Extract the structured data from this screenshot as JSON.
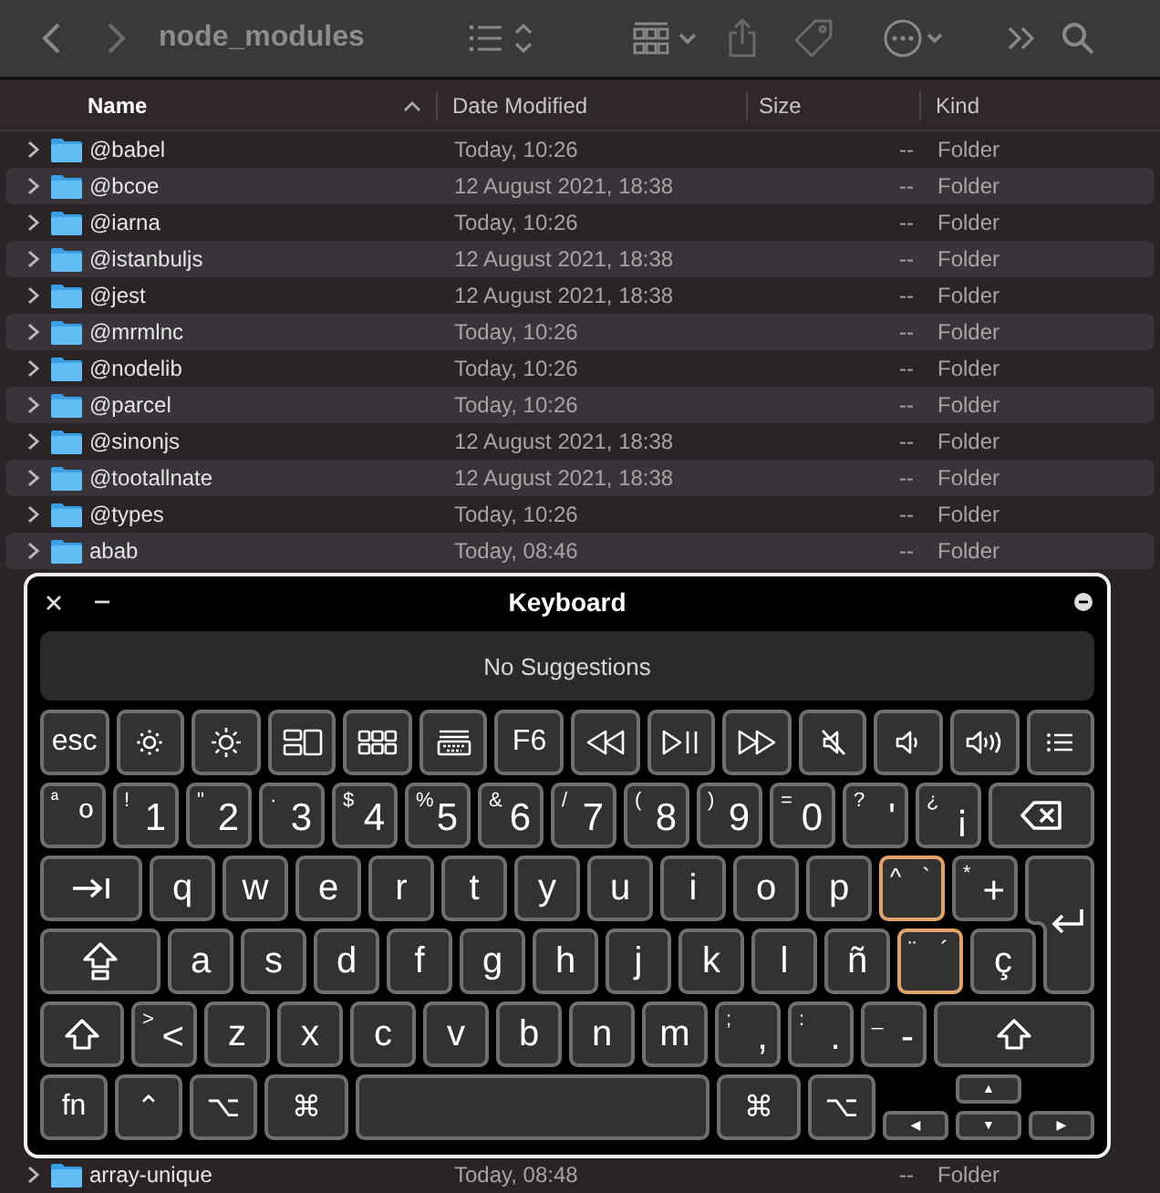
{
  "toolbar": {
    "title": "node_modules"
  },
  "columns": [
    {
      "label": "Name",
      "sorted": true
    },
    {
      "label": "Date Modified",
      "sorted": false
    },
    {
      "label": "Size",
      "sorted": false
    },
    {
      "label": "Kind",
      "sorted": false
    }
  ],
  "rows": [
    {
      "name": "@babel",
      "date": "Today, 10:26",
      "size": "--",
      "kind_text": "Folder",
      "expanded": false
    },
    {
      "name": "@bcoe",
      "date": "12 August 2021, 18:38",
      "size": "--",
      "kind_text": "Folder",
      "expanded": false
    },
    {
      "name": "@iarna",
      "date": "Today, 10:26",
      "size": "--",
      "kind_text": "Folder",
      "expanded": false
    },
    {
      "name": "@istanbuljs",
      "date": "12 August 2021, 18:38",
      "size": "--",
      "kind_text": "Folder",
      "expanded": false
    },
    {
      "name": "@jest",
      "date": "12 August 2021, 18:38",
      "size": "--",
      "kind_text": "Folder",
      "expanded": false
    },
    {
      "name": "@mrmlnc",
      "date": "Today, 10:26",
      "size": "--",
      "kind_text": "Folder",
      "expanded": false
    },
    {
      "name": "@nodelib",
      "date": "Today, 10:26",
      "size": "--",
      "kind_text": "Folder",
      "expanded": false
    },
    {
      "name": "@parcel",
      "date": "Today, 10:26",
      "size": "--",
      "kind_text": "Folder",
      "expanded": false
    },
    {
      "name": "@sinonjs",
      "date": "12 August 2021, 18:38",
      "size": "--",
      "kind_text": "Folder",
      "expanded": false
    },
    {
      "name": "@tootallnate",
      "date": "12 August 2021, 18:38",
      "size": "--",
      "kind_text": "Folder",
      "expanded": false
    },
    {
      "name": "@types",
      "date": "Today, 10:26",
      "size": "--",
      "kind_text": "Folder",
      "expanded": false
    },
    {
      "name": "abab",
      "date": "Today, 08:46",
      "size": "--",
      "kind_text": "Folder",
      "expanded": false
    }
  ],
  "bottom_rows": [
    {
      "name": "array-unique",
      "date": "Today, 08:48",
      "size": "--",
      "kind_text": "Folder",
      "expanded": false
    }
  ],
  "keyboard": {
    "title": "Keyboard",
    "suggestions": "No Suggestions",
    "rows": [
      [
        {
          "kind": "label",
          "label": "esc",
          "highlighted": false
        },
        {
          "kind": "icon",
          "highlighted": false
        },
        {
          "kind": "icon",
          "highlighted": false
        },
        {
          "kind": "icon",
          "highlighted": false
        },
        {
          "kind": "icon",
          "highlighted": false
        },
        {
          "kind": "icon",
          "highlighted": false
        },
        {
          "kind": "label",
          "label": "F6",
          "highlighted": false
        },
        {
          "kind": "icon",
          "highlighted": false
        },
        {
          "kind": "icon",
          "highlighted": false
        },
        {
          "kind": "icon",
          "highlighted": false
        },
        {
          "kind": "icon",
          "highlighted": false
        },
        {
          "kind": "icon",
          "highlighted": false
        },
        {
          "kind": "icon",
          "highlighted": false
        },
        {
          "kind": "icon",
          "highlighted": false
        }
      ],
      [
        {
          "kind": "dual",
          "shift": "ª",
          "main": "º",
          "highlighted": false
        },
        {
          "kind": "dual",
          "shift": "!",
          "main": "1",
          "highlighted": false
        },
        {
          "kind": "dual",
          "shift": "\"",
          "main": "2",
          "highlighted": false
        },
        {
          "kind": "dual",
          "shift": "·",
          "main": "3",
          "highlighted": false
        },
        {
          "kind": "dual",
          "shift": "$",
          "main": "4",
          "highlighted": false
        },
        {
          "kind": "dual",
          "shift": "%",
          "main": "5",
          "highlighted": false
        },
        {
          "kind": "dual",
          "shift": "&",
          "main": "6",
          "highlighted": false
        },
        {
          "kind": "dual",
          "shift": "/",
          "main": "7",
          "highlighted": false
        },
        {
          "kind": "dual",
          "shift": "(",
          "main": "8",
          "highlighted": false
        },
        {
          "kind": "dual",
          "shift": ")",
          "main": "9",
          "highlighted": false
        },
        {
          "kind": "dual",
          "shift": "=",
          "main": "0",
          "highlighted": false
        },
        {
          "kind": "dual",
          "shift": "?",
          "main": "'",
          "highlighted": false
        },
        {
          "kind": "dual",
          "shift": "¿",
          "main": "¡",
          "highlighted": false
        },
        {
          "kind": "icon",
          "highlighted": false
        }
      ],
      [
        {
          "kind": "icon",
          "highlighted": false
        },
        {
          "kind": "letter",
          "label": "q",
          "highlighted": false
        },
        {
          "kind": "letter",
          "label": "w",
          "highlighted": false
        },
        {
          "kind": "letter",
          "label": "e",
          "highlighted": false
        },
        {
          "kind": "letter",
          "label": "r",
          "highlighted": false
        },
        {
          "kind": "letter",
          "label": "t",
          "highlighted": false
        },
        {
          "kind": "letter",
          "label": "y",
          "highlighted": false
        },
        {
          "kind": "letter",
          "label": "u",
          "highlighted": false
        },
        {
          "kind": "letter",
          "label": "i",
          "highlighted": false
        },
        {
          "kind": "letter",
          "label": "o",
          "highlighted": false
        },
        {
          "kind": "letter",
          "label": "p",
          "highlighted": false
        },
        {
          "kind": "dead",
          "shift": "^",
          "main": "`",
          "highlighted": true
        },
        {
          "kind": "dual",
          "shift": "*",
          "main": "+",
          "highlighted": false
        },
        {
          "kind": "return",
          "highlighted": false
        }
      ],
      [
        {
          "kind": "icon",
          "highlighted": false
        },
        {
          "kind": "letter",
          "label": "a",
          "highlighted": false
        },
        {
          "kind": "letter",
          "label": "s",
          "highlighted": false
        },
        {
          "kind": "letter",
          "label": "d",
          "highlighted": false
        },
        {
          "kind": "letter",
          "label": "f",
          "highlighted": false
        },
        {
          "kind": "letter",
          "label": "g",
          "highlighted": false
        },
        {
          "kind": "letter",
          "label": "h",
          "highlighted": false
        },
        {
          "kind": "letter",
          "label": "j",
          "highlighted": false
        },
        {
          "kind": "letter",
          "label": "k",
          "highlighted": false
        },
        {
          "kind": "letter",
          "label": "l",
          "highlighted": false
        },
        {
          "kind": "letter",
          "label": "ñ",
          "highlighted": false
        },
        {
          "kind": "dead",
          "shift": "¨",
          "main": "´",
          "highlighted": true
        },
        {
          "kind": "letter",
          "label": "ç",
          "highlighted": false
        }
      ],
      [
        {
          "kind": "icon",
          "highlighted": false
        },
        {
          "kind": "dual",
          "shift": ">",
          "main": "<",
          "highlighted": false
        },
        {
          "kind": "letter",
          "label": "z",
          "highlighted": false
        },
        {
          "kind": "letter",
          "label": "x",
          "highlighted": false
        },
        {
          "kind": "letter",
          "label": "c",
          "highlighted": false
        },
        {
          "kind": "letter",
          "label": "v",
          "highlighted": false
        },
        {
          "kind": "letter",
          "label": "b",
          "highlighted": false
        },
        {
          "kind": "letter",
          "label": "n",
          "highlighted": false
        },
        {
          "kind": "letter",
          "label": "m",
          "highlighted": false
        },
        {
          "kind": "dual",
          "shift": ";",
          "main": ",",
          "highlighted": false
        },
        {
          "kind": "dual",
          "shift": ":",
          "main": ".",
          "highlighted": false
        },
        {
          "kind": "dual",
          "shift": "_",
          "main": "-",
          "highlighted": false
        },
        {
          "kind": "icon",
          "highlighted": false
        }
      ],
      [
        {
          "kind": "label",
          "label": "fn",
          "highlighted": false
        },
        {
          "kind": "label",
          "label": "⌃",
          "highlighted": false
        },
        {
          "kind": "label",
          "label": "⌥",
          "highlighted": false
        },
        {
          "kind": "label",
          "label": "⌘",
          "highlighted": false
        },
        {
          "kind": "space",
          "highlighted": false
        },
        {
          "kind": "label",
          "label": "⌘",
          "highlighted": false
        },
        {
          "kind": "label",
          "label": "⌥",
          "highlighted": false
        },
        {
          "kind": "arrow",
          "label": "▲",
          "highlighted": false
        },
        {
          "kind": "arrow",
          "label": "◀",
          "highlighted": false
        },
        {
          "kind": "arrow",
          "label": "▼",
          "highlighted": false
        },
        {
          "kind": "arrow",
          "label": "▶",
          "highlighted": false
        }
      ]
    ]
  }
}
